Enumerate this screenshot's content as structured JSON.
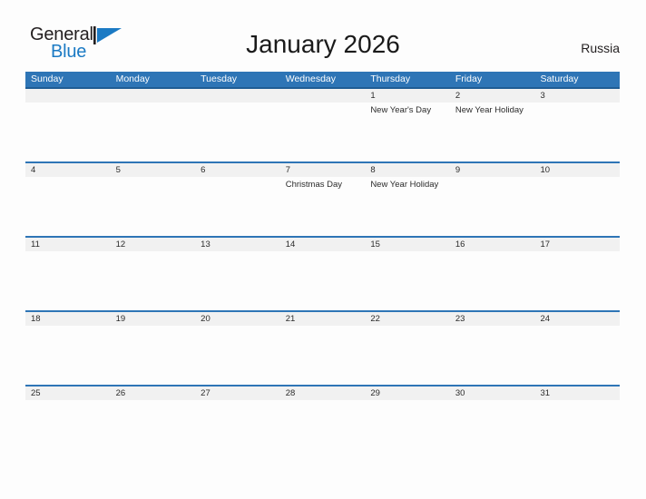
{
  "brand": {
    "name_part1": "General",
    "name_part2": "Blue",
    "logo_icon": "triangle-flag-icon",
    "accent_color": "#1b7ac4"
  },
  "header": {
    "title": "January 2026",
    "region": "Russia"
  },
  "colors": {
    "header_blue": "#2e75b6",
    "header_blue_border": "#1f5c94",
    "row_band_gray": "#f1f1f1",
    "text_dark": "#2b2b2b",
    "background": "#fdfdfd"
  },
  "calendar": {
    "month": "January",
    "year": "2026",
    "weekday_headers": [
      "Sunday",
      "Monday",
      "Tuesday",
      "Wednesday",
      "Thursday",
      "Friday",
      "Saturday"
    ],
    "weeks": [
      {
        "days": [
          {
            "date": "",
            "events": []
          },
          {
            "date": "",
            "events": []
          },
          {
            "date": "",
            "events": []
          },
          {
            "date": "",
            "events": []
          },
          {
            "date": "1",
            "events": [
              "New Year's Day"
            ]
          },
          {
            "date": "2",
            "events": [
              "New Year Holiday"
            ]
          },
          {
            "date": "3",
            "events": []
          }
        ]
      },
      {
        "days": [
          {
            "date": "4",
            "events": []
          },
          {
            "date": "5",
            "events": []
          },
          {
            "date": "6",
            "events": []
          },
          {
            "date": "7",
            "events": [
              "Christmas Day"
            ]
          },
          {
            "date": "8",
            "events": [
              "New Year Holiday"
            ]
          },
          {
            "date": "9",
            "events": []
          },
          {
            "date": "10",
            "events": []
          }
        ]
      },
      {
        "days": [
          {
            "date": "11",
            "events": []
          },
          {
            "date": "12",
            "events": []
          },
          {
            "date": "13",
            "events": []
          },
          {
            "date": "14",
            "events": []
          },
          {
            "date": "15",
            "events": []
          },
          {
            "date": "16",
            "events": []
          },
          {
            "date": "17",
            "events": []
          }
        ]
      },
      {
        "days": [
          {
            "date": "18",
            "events": []
          },
          {
            "date": "19",
            "events": []
          },
          {
            "date": "20",
            "events": []
          },
          {
            "date": "21",
            "events": []
          },
          {
            "date": "22",
            "events": []
          },
          {
            "date": "23",
            "events": []
          },
          {
            "date": "24",
            "events": []
          }
        ]
      },
      {
        "days": [
          {
            "date": "25",
            "events": []
          },
          {
            "date": "26",
            "events": []
          },
          {
            "date": "27",
            "events": []
          },
          {
            "date": "28",
            "events": []
          },
          {
            "date": "29",
            "events": []
          },
          {
            "date": "30",
            "events": []
          },
          {
            "date": "31",
            "events": []
          }
        ]
      }
    ]
  }
}
